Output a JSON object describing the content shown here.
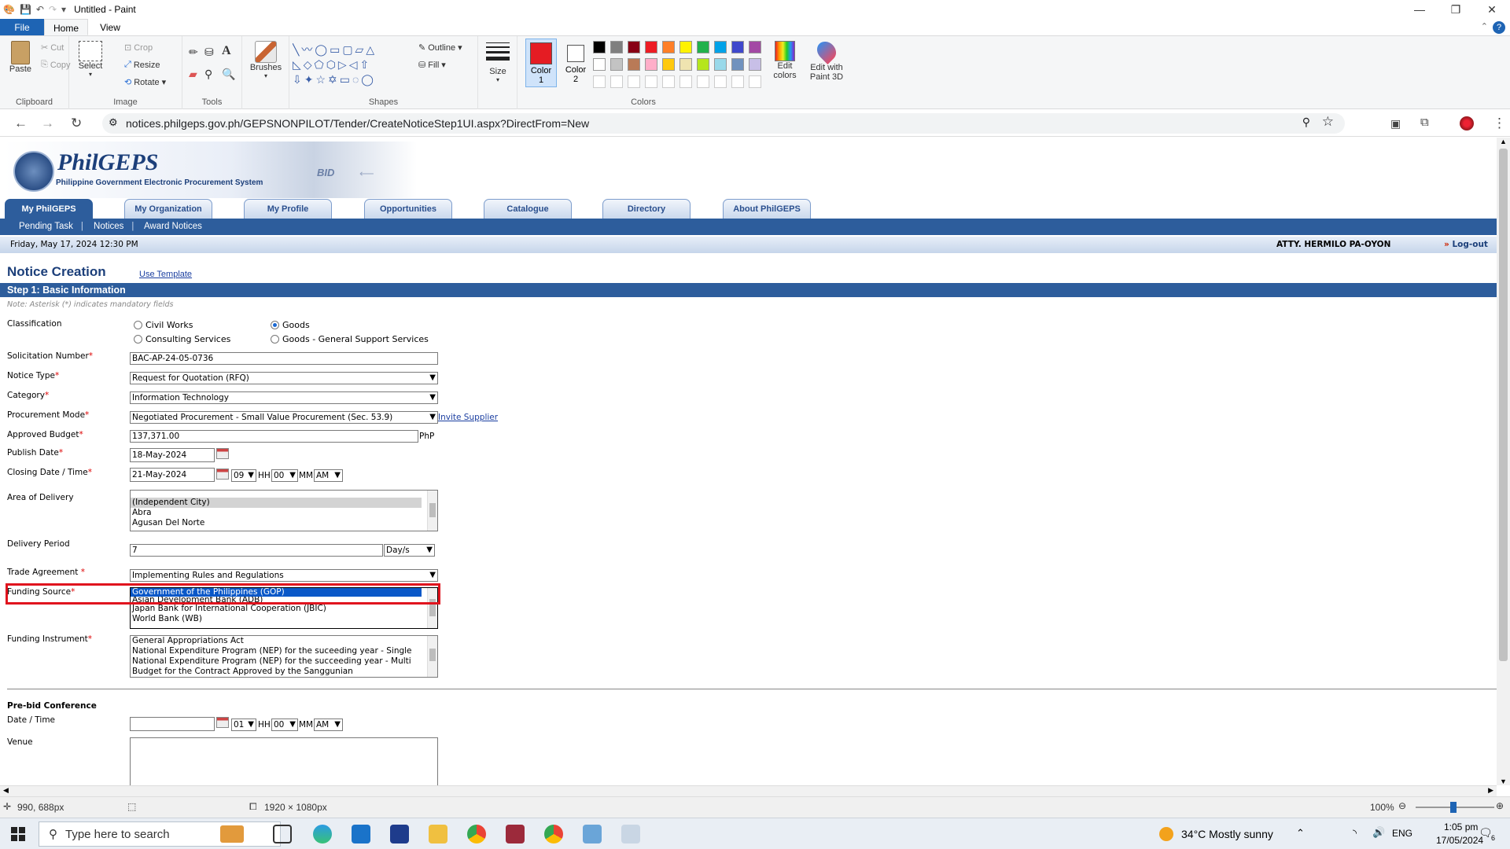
{
  "paint": {
    "title": "Untitled - Paint",
    "menu_tabs": [
      "File",
      "Home",
      "View"
    ],
    "clipboard": {
      "paste": "Paste",
      "cut": "Cut",
      "copy": "Copy",
      "group": "Clipboard"
    },
    "image": {
      "select": "Select",
      "crop": "Crop",
      "resize": "Resize",
      "rotate": "Rotate",
      "group": "Image"
    },
    "tools": {
      "group": "Tools"
    },
    "brushes": "Brushes",
    "shapes": {
      "outline": "Outline",
      "fill": "Fill",
      "group": "Shapes"
    },
    "size": "Size",
    "color1": {
      "label": "Color",
      "num": "1",
      "value": "#e51c23"
    },
    "color2": {
      "label": "Color",
      "num": "2",
      "value": "#ffffff"
    },
    "colors_group": "Colors",
    "edit_colors": "Edit colors",
    "edit_paint3d": "Edit with Paint 3D",
    "palette_row1": [
      "#000000",
      "#7f7f7f",
      "#880015",
      "#ed1c24",
      "#ff7f27",
      "#fff200",
      "#22b14c",
      "#00a2e8",
      "#3f48cc",
      "#a349a4"
    ],
    "palette_row2": [
      "#ffffff",
      "#c3c3c3",
      "#b97a57",
      "#ffaec9",
      "#ffc90e",
      "#efe4b0",
      "#b5e61d",
      "#99d9ea",
      "#7092be",
      "#c8bfe7"
    ],
    "status": {
      "cursor": "990, 688px",
      "dimensions": "1920 × 1080px",
      "zoom": "100%"
    }
  },
  "browser": {
    "url": "notices.philgeps.gov.ph/GEPSNONPILOT/Tender/CreateNoticeStep1UI.aspx?DirectFrom=New"
  },
  "site": {
    "logo": "PhilGEPS",
    "logo_sub": "Philippine Government Electronic Procurement System",
    "banner_word": "BID",
    "nav": [
      "My PhilGEPS",
      "My Organization",
      "My Profile",
      "Opportunities",
      "Catalogue",
      "Directory",
      "About PhilGEPS"
    ],
    "subnav": [
      "Pending Task",
      "Notices",
      "Award Notices"
    ],
    "date": "Friday, May 17, 2024 12:30 PM",
    "user": "ATTY. HERMILO PA-OYON",
    "logout": "Log-out"
  },
  "form": {
    "title": "Notice Creation",
    "use_template": "Use Template",
    "step": "Step 1: Basic Information",
    "note": "Note: Asterisk (*) indicates mandatory fields",
    "classification": {
      "label": "Classification",
      "options": [
        "Civil Works",
        "Goods",
        "Consulting Services",
        "Goods - General Support Services"
      ],
      "selected": "Goods"
    },
    "solicitation": {
      "label": "Solicitation Number",
      "value": "BAC-AP-24-05-0736"
    },
    "notice_type": {
      "label": "Notice Type",
      "value": "Request for Quotation (RFQ)"
    },
    "category": {
      "label": "Category",
      "value": "Information Technology"
    },
    "proc_mode": {
      "label": "Procurement Mode",
      "value": "Negotiated Procurement - Small Value Procurement (Sec. 53.9)",
      "invite": "Invite Supplier"
    },
    "budget": {
      "label": "Approved Budget",
      "value": "137,371.00",
      "unit": "PhP"
    },
    "publish": {
      "label": "Publish Date",
      "value": "18-May-2024"
    },
    "closing": {
      "label": "Closing Date / Time",
      "date": "21-May-2024",
      "hh": "09",
      "hh_label": "HH",
      "mm": "00",
      "mm_label": "MM",
      "ampm": "AM"
    },
    "delivery_area": {
      "label": "Area of Delivery",
      "options": [
        "(Independent City)",
        "Abra",
        "Agusan Del Norte"
      ]
    },
    "delivery_period": {
      "label": "Delivery Period",
      "value": "7",
      "unit": "Day/s"
    },
    "trade": {
      "label": "Trade Agreement",
      "value": "Implementing Rules and Regulations"
    },
    "funding_source": {
      "label": "Funding Source",
      "options": [
        "Government of the Philippines (GOP)",
        "Asian Development Bank (ADB)",
        "Japan Bank for International Cooperation (JBIC)",
        "World Bank (WB)"
      ]
    },
    "funding_instrument": {
      "label": "Funding Instrument",
      "options": [
        "General Appropriations Act",
        "National Expenditure Program (NEP) for the suceeding year - Single",
        "National Expenditure Program (NEP) for the succeeding year - Multi",
        "Budget for the Contract Approved by the Sanggunian"
      ]
    },
    "prebid": {
      "heading": "Pre-bid Conference",
      "date_label": "Date / Time",
      "hh": "01",
      "mm": "00",
      "ampm": "AM",
      "venue_label": "Venue"
    }
  },
  "taskbar": {
    "search": "Type here to search",
    "weather": "34°C  Mostly sunny",
    "lang": "ENG",
    "time": "1:05 pm",
    "date": "17/05/2024",
    "notif": "6"
  }
}
